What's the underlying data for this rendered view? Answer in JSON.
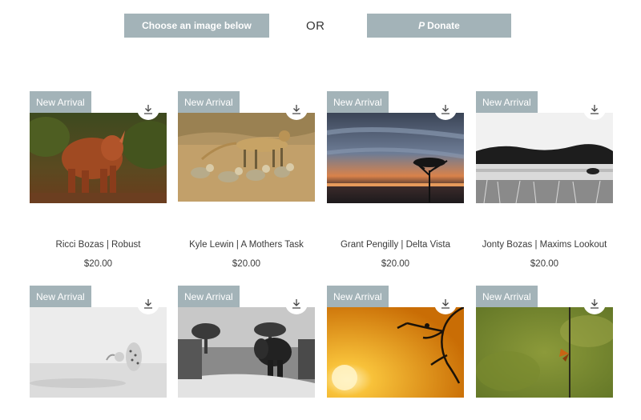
{
  "top_bar": {
    "choose_label": "Choose an image below",
    "or_label": "OR",
    "donate_label": "Donate",
    "donate_icon": "paypal-icon"
  },
  "colors": {
    "button_bg": "#a3b3b8",
    "badge_bg": "#a3b3b8",
    "text": "#3a3a3a"
  },
  "products": [
    {
      "badge": "New Arrival",
      "title": "Ricci Bozas | Robust",
      "price": "$20.00",
      "image": "rhino-photo",
      "download_icon": "download-icon"
    },
    {
      "badge": "New Arrival",
      "title": "Kyle Lewin | A Mothers Task",
      "price": "$20.00",
      "image": "cheetah-family-photo",
      "download_icon": "download-icon"
    },
    {
      "badge": "New Arrival",
      "title": "Grant Pengilly | Delta Vista",
      "price": "$20.00",
      "image": "delta-sunset-photo",
      "download_icon": "download-icon"
    },
    {
      "badge": "New Arrival",
      "title": "Jonty Bozas | Maxims Lookout",
      "price": "$20.00",
      "image": "river-rhino-bw-photo",
      "download_icon": "download-icon"
    },
    {
      "badge": "New Arrival",
      "image": "leopard-mist-photo",
      "download_icon": "download-icon"
    },
    {
      "badge": "New Arrival",
      "image": "elephant-bw-photo",
      "download_icon": "download-icon"
    },
    {
      "badge": "New Arrival",
      "image": "golden-sunset-tree-photo",
      "download_icon": "download-icon"
    },
    {
      "badge": "New Arrival",
      "image": "butterfly-photo",
      "download_icon": "download-icon"
    }
  ]
}
